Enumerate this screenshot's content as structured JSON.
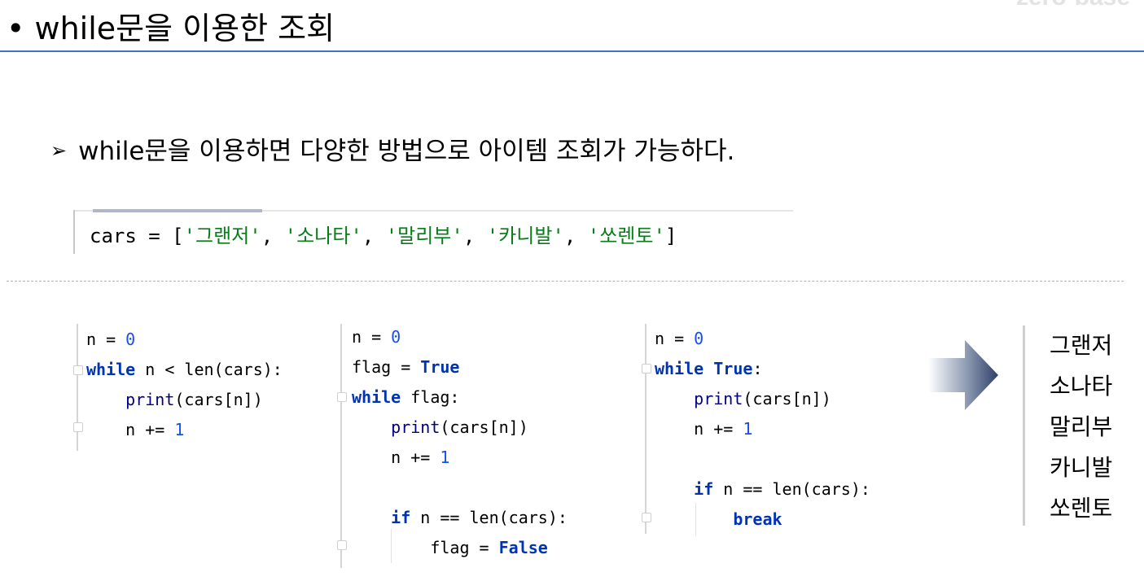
{
  "header": {
    "title": "• while문을 이용한 조회",
    "corner_text": "zero-base"
  },
  "bullet": {
    "marker": "➢",
    "text": "while문을 이용하면 다양한 방법으로 아이템 조회가 가능하다."
  },
  "cars_line": {
    "var": "cars",
    "op": " = [",
    "items": [
      "'그랜저'",
      "'소나타'",
      "'말리부'",
      "'카니발'",
      "'쏘렌토'"
    ],
    "sep": ", ",
    "close": "]"
  },
  "code1": {
    "l1_var": "n = ",
    "l1_num": "0",
    "l2_kw": "while",
    "l2_rest": " n < len(cars):",
    "l3_indent": "    ",
    "l3_fn": "print",
    "l3_rest": "(cars[n])",
    "l4_text": "    n += ",
    "l4_num": "1"
  },
  "code2": {
    "l1_var": "n = ",
    "l1_num": "0",
    "l2_var": "flag = ",
    "l2_kw": "True",
    "l3_kw": "while",
    "l3_rest": " flag:",
    "l4_indent": "    ",
    "l4_fn": "print",
    "l4_rest": "(cars[n])",
    "l5_text": "    n += ",
    "l5_num": "1",
    "l7_indent": "    ",
    "l7_kw": "if",
    "l7_rest": " n == len(cars):",
    "l8_text": "        flag = ",
    "l8_kw": "False"
  },
  "code3": {
    "l1_var": "n = ",
    "l1_num": "0",
    "l2_kw": "while",
    "l2_sp": " ",
    "l2_kw2": "True",
    "l2_rest": ":",
    "l3_indent": "    ",
    "l3_fn": "print",
    "l3_rest": "(cars[n])",
    "l4_text": "    n += ",
    "l4_num": "1",
    "l6_indent": "    ",
    "l6_kw": "if",
    "l6_rest": " n == len(cars):",
    "l7_indent": "        ",
    "l7_kw": "break"
  },
  "output": {
    "lines": [
      "그랜저",
      "소나타",
      "말리부",
      "카니발",
      "쏘렌토"
    ]
  },
  "colors": {
    "keyword": "#0033b3",
    "number": "#1750eb",
    "string": "#067d17",
    "rule": "#4472c4"
  }
}
